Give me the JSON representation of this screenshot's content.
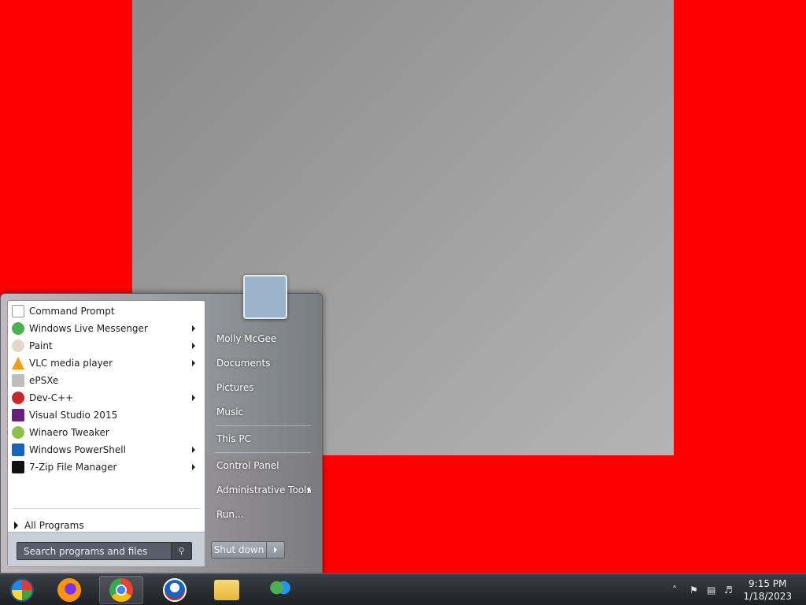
{
  "wallpaper": {
    "note": "explicit image omitted"
  },
  "start_menu": {
    "programs": [
      {
        "label": "Command Prompt",
        "icon": "cmd-icon",
        "has_submenu": false
      },
      {
        "label": "Windows Live Messenger",
        "icon": "messenger-icon",
        "has_submenu": true
      },
      {
        "label": "Paint",
        "icon": "paint-icon",
        "has_submenu": true
      },
      {
        "label": "VLC media player",
        "icon": "vlc-icon",
        "has_submenu": true
      },
      {
        "label": "ePSXe",
        "icon": "epsxe-icon",
        "has_submenu": false
      },
      {
        "label": "Dev-C++",
        "icon": "devcpp-icon",
        "has_submenu": true
      },
      {
        "label": "Visual Studio 2015",
        "icon": "visual-studio-icon",
        "has_submenu": false
      },
      {
        "label": "Winaero Tweaker",
        "icon": "winaero-icon",
        "has_submenu": false
      },
      {
        "label": "Windows PowerShell",
        "icon": "powershell-icon",
        "has_submenu": true
      },
      {
        "label": "7-Zip File Manager",
        "icon": "7zip-icon",
        "has_submenu": true
      }
    ],
    "all_programs": "All Programs",
    "search_placeholder": "Search programs and files",
    "right_items": [
      {
        "label": "Molly McGee",
        "has_submenu": false
      },
      {
        "label": "Documents",
        "has_submenu": false
      },
      {
        "label": "Pictures",
        "has_submenu": false
      },
      {
        "label": "Music",
        "has_submenu": false
      },
      {
        "label": "This PC",
        "has_submenu": false
      },
      {
        "label": "Control Panel",
        "has_submenu": false
      },
      {
        "label": "Administrative Tools",
        "has_submenu": true
      },
      {
        "label": "Run...",
        "has_submenu": false
      }
    ],
    "shutdown_label": "Shut down"
  },
  "taskbar": {
    "buttons": [
      {
        "name": "start-orb",
        "icon": "windows-orb-icon"
      },
      {
        "name": "firefox",
        "icon": "firefox-icon"
      },
      {
        "name": "chrome",
        "icon": "chrome-icon"
      },
      {
        "name": "obama-logo",
        "icon": "obama-logo-icon"
      },
      {
        "name": "file-explorer",
        "icon": "folder-icon"
      },
      {
        "name": "windows-live-messenger",
        "icon": "messenger-icon"
      }
    ],
    "clock": {
      "time": "9:15 PM",
      "date": "1/18/2023"
    }
  }
}
